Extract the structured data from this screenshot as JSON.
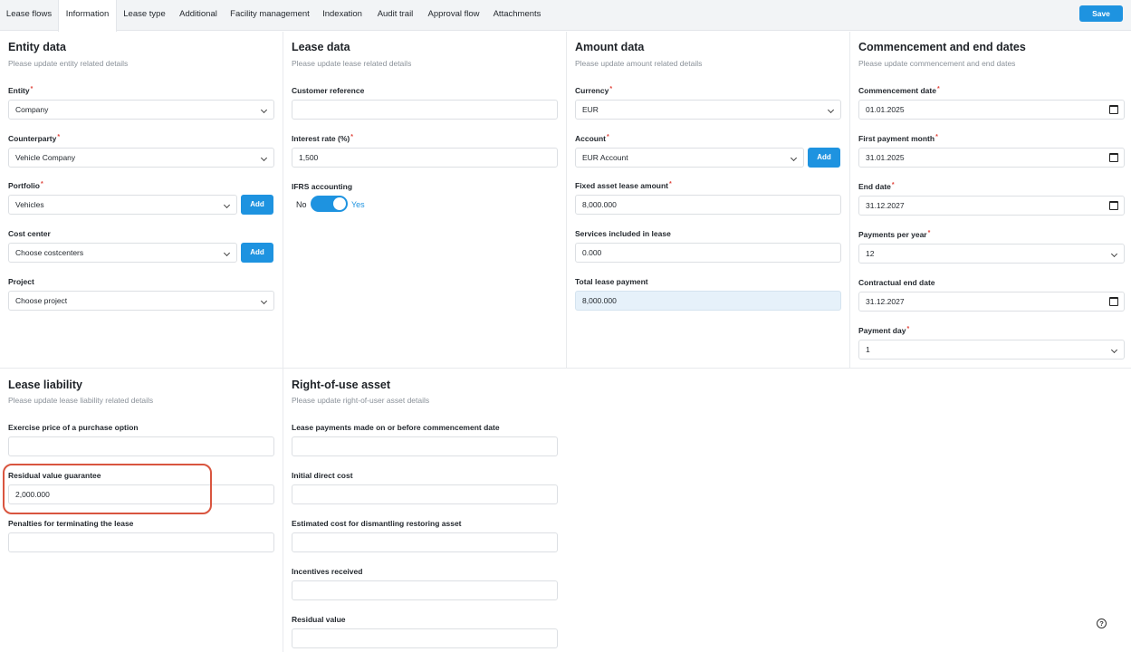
{
  "tabs": [
    {
      "label": "Lease flows"
    },
    {
      "label": "Information"
    },
    {
      "label": "Lease type"
    },
    {
      "label": "Additional"
    },
    {
      "label": "Facility management"
    },
    {
      "label": "Indexation"
    },
    {
      "label": "Audit trail"
    },
    {
      "label": "Approval flow"
    },
    {
      "label": "Attachments"
    }
  ],
  "active_tab": "Information",
  "save_label": "Save",
  "entity": {
    "title": "Entity data",
    "subtitle": "Please update entity related details",
    "entity_label": "Entity",
    "entity_value": "Company",
    "counterparty_label": "Counterparty",
    "counterparty_value": "Vehicle Company",
    "portfolio_label": "Portfolio",
    "portfolio_value": "Vehicles",
    "cost_center_label": "Cost center",
    "cost_center_value": "Choose costcenters",
    "project_label": "Project",
    "project_value": "Choose project",
    "add_label": "Add"
  },
  "lease": {
    "title": "Lease data",
    "subtitle": "Please update lease related details",
    "customer_ref_label": "Customer reference",
    "customer_ref_value": "",
    "interest_label": "Interest rate (%)",
    "interest_value": "1,500",
    "ifrs_label": "IFRS accounting",
    "toggle_no": "No",
    "toggle_yes": "Yes"
  },
  "amount": {
    "title": "Amount data",
    "subtitle": "Please update amount related details",
    "currency_label": "Currency",
    "currency_value": "EUR",
    "account_label": "Account",
    "account_value": "EUR Account",
    "add_label": "Add",
    "fixed_label": "Fixed asset lease amount",
    "fixed_value": "8,000.000",
    "services_label": "Services included in lease",
    "services_value": "0.000",
    "total_label": "Total lease payment",
    "total_value": "8,000.000"
  },
  "dates": {
    "title": "Commencement and end dates",
    "subtitle": "Please update commencement and end dates",
    "commencement_label": "Commencement date",
    "commencement_value": "01.01.2025",
    "first_payment_label": "First payment month",
    "first_payment_value": "31.01.2025",
    "end_label": "End date",
    "end_value": "31.12.2027",
    "ppy_label": "Payments per year",
    "ppy_value": "12",
    "contract_end_label": "Contractual end date",
    "contract_end_value": "31.12.2027",
    "payment_day_label": "Payment day",
    "payment_day_value": "1"
  },
  "liability": {
    "title": "Lease liability",
    "subtitle": "Please update lease liability related details",
    "exercise_label": "Exercise price of a purchase option",
    "exercise_value": "",
    "residual_label": "Residual value guarantee",
    "residual_value": "2,000.000",
    "penalties_label": "Penalties for terminating the lease",
    "penalties_value": ""
  },
  "rou": {
    "title": "Right-of-use asset",
    "subtitle": "Please update right-of-user asset details",
    "payments_before_label": "Lease payments made on or before commencement date",
    "initial_cost_label": "Initial direct cost",
    "dismantling_label": "Estimated cost for dismantling restoring asset",
    "incentives_label": "Incentives received",
    "residual_label": "Residual value"
  },
  "help_glyph": "?"
}
